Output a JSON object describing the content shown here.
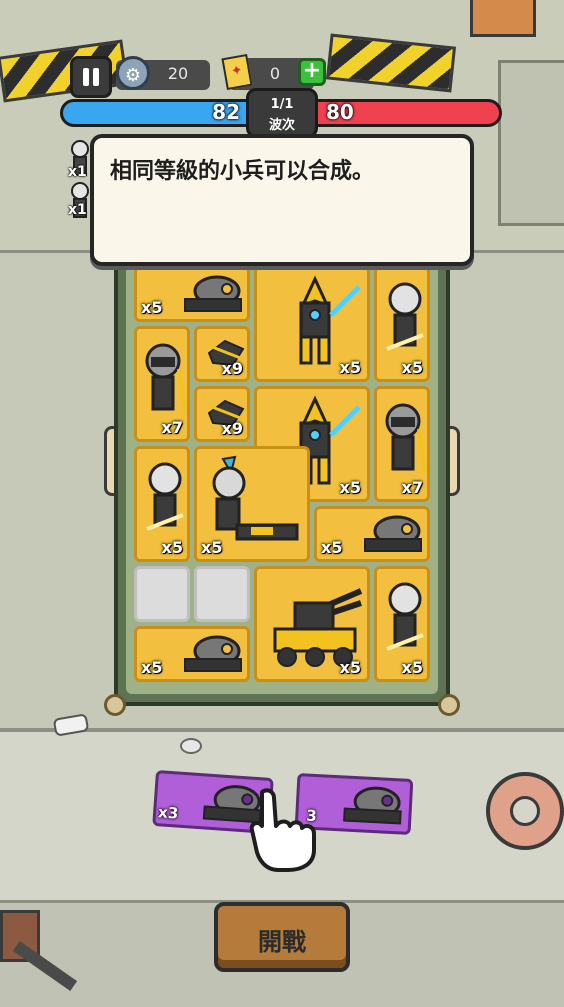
{
  "hud": {
    "coins": "20",
    "tickets": "0",
    "add_symbol": "+",
    "colors": {
      "player": "#39a6f0",
      "enemy": "#f0414f"
    }
  },
  "battle": {
    "player_hp": "82",
    "enemy_hp": "80",
    "wave_count": "1/1",
    "wave_label": "波次"
  },
  "tutorial": {
    "tip": "相同等級的小兵可以合成。"
  },
  "side_units": [
    {
      "count": "x1"
    },
    {
      "count": "x1"
    }
  ],
  "board": {
    "cells": [
      {
        "unit": "drone-bot",
        "count": "x5"
      },
      {
        "unit": "yellow-mech",
        "count": "x5"
      },
      {
        "unit": "silver-swordsman",
        "count": "x5"
      },
      {
        "unit": "gasmask-soldier",
        "count": "x7"
      },
      {
        "unit": "mini-drone",
        "count": "x9"
      },
      {
        "unit": "mini-drone",
        "count": "x9"
      },
      {
        "unit": "yellow-mech",
        "count": "x5"
      },
      {
        "unit": "gasmask-soldier",
        "count": "x7"
      },
      {
        "unit": "silver-swordsman",
        "count": "x5"
      },
      {
        "unit": "mohawk-gunner",
        "count": "x5"
      },
      {
        "unit": "drone-bot",
        "count": "x5"
      },
      {
        "unit": "tank-turret",
        "count": "x5"
      },
      {
        "unit": "silver-swordsman",
        "count": "x5"
      },
      {
        "unit": "drone-bot",
        "count": "x5"
      }
    ]
  },
  "deck": {
    "cards": [
      {
        "unit": "drone-bot",
        "count": "x3"
      },
      {
        "unit": "drone-bot",
        "count": "3"
      }
    ]
  },
  "start_button": {
    "label": "開戰"
  }
}
